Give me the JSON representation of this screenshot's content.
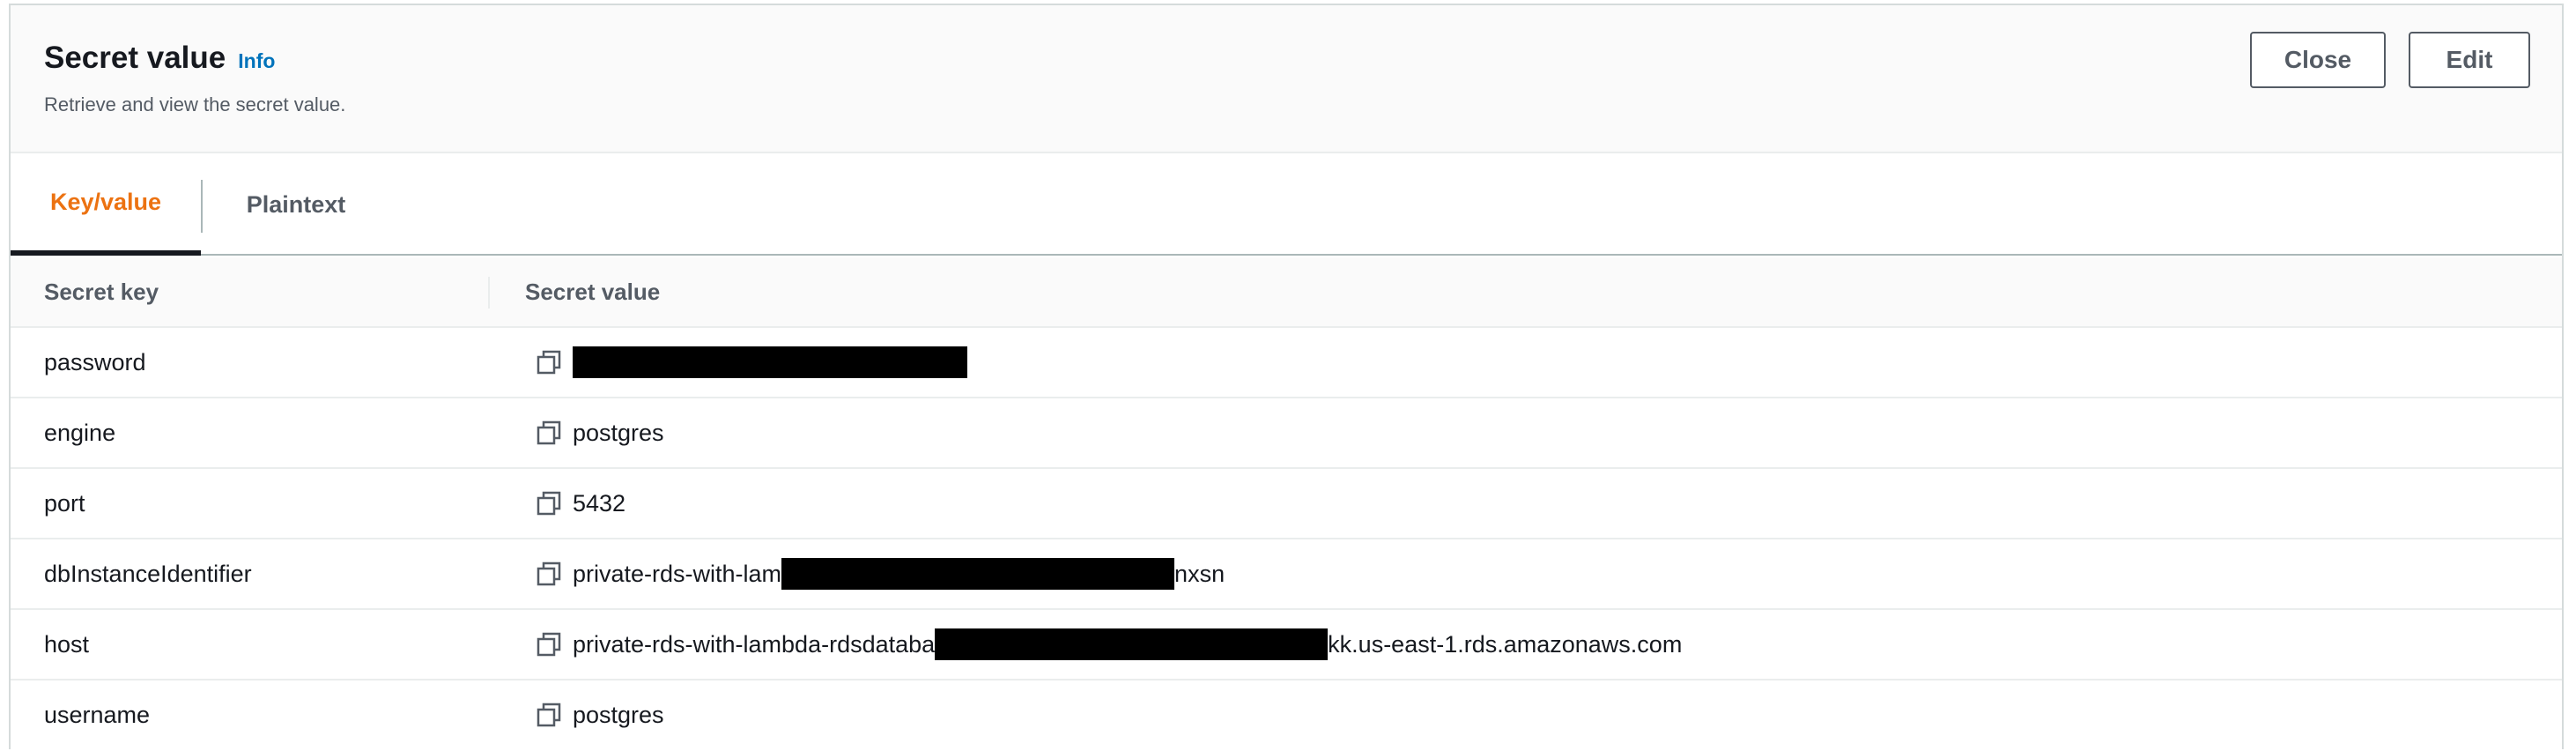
{
  "header": {
    "title": "Secret value",
    "info_label": "Info",
    "description": "Retrieve and view the secret value.",
    "close_label": "Close",
    "edit_label": "Edit"
  },
  "tabs": [
    {
      "label": "Key/value",
      "active": true
    },
    {
      "label": "Plaintext",
      "active": false
    }
  ],
  "table": {
    "columns": [
      "Secret key",
      "Secret value"
    ],
    "rows": [
      {
        "key": "password",
        "value_prefix": "",
        "value_suffix": "",
        "redacted": true
      },
      {
        "key": "engine",
        "value_prefix": "postgres",
        "value_suffix": "",
        "redacted": false
      },
      {
        "key": "port",
        "value_prefix": "5432",
        "value_suffix": "",
        "redacted": false
      },
      {
        "key": "dbInstanceIdentifier",
        "value_prefix": "private-rds-with-lam",
        "value_suffix": "nxsn",
        "redacted": true
      },
      {
        "key": "host",
        "value_prefix": "private-rds-with-lambda-rdsdataba",
        "value_suffix": "kk.us-east-1.rds.amazonaws.com",
        "redacted": true
      },
      {
        "key": "username",
        "value_prefix": "postgres",
        "value_suffix": "",
        "redacted": false
      }
    ]
  },
  "icons": {
    "copy": "copy-icon"
  },
  "colors": {
    "active_tab": "#ec7211",
    "link": "#0073bb",
    "redaction": "#000000"
  }
}
